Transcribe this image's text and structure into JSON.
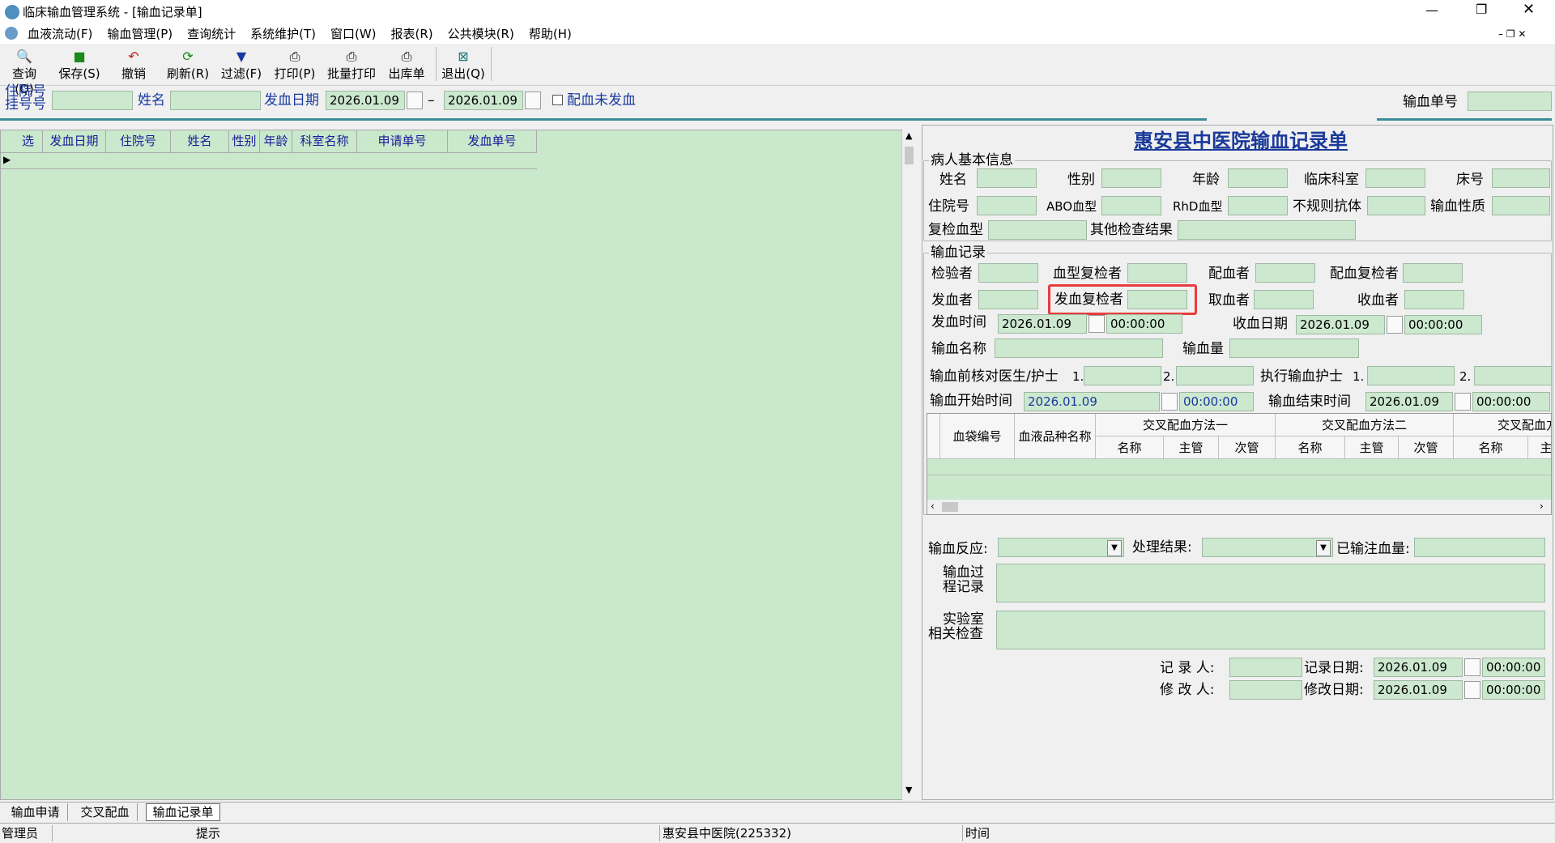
{
  "window": {
    "title": "临床输血管理系统 - [输血记录单]"
  },
  "menu": [
    "血液流动(F)",
    "输血管理(P)",
    "查询统计",
    "系统维护(T)",
    "窗口(W)",
    "报表(R)",
    "公共模块(R)",
    "帮助(H)"
  ],
  "toolbar": {
    "query": "查询(Q)",
    "save": "保存(S)",
    "undo": "撤销",
    "refresh": "刷新(R)",
    "filter": "过滤(F)",
    "print": "打印(P)",
    "batch_print": "批量打印",
    "outbound": "出库单",
    "exit": "退出(Q)"
  },
  "filter": {
    "inpatient_label_1": "住院号",
    "inpatient_label_2": "挂号号",
    "name_label": "姓名",
    "date_label": "发血日期",
    "date_from": "2026.01.09",
    "date_to": "2026.01.09",
    "dash": "–",
    "matched_label": "配血未发血",
    "order_no_label": "输血单号"
  },
  "list": {
    "columns": [
      "选",
      "发血日期",
      "住院号",
      "姓名",
      "性别",
      "年龄",
      "科室名称",
      "申请单号",
      "发血单号"
    ]
  },
  "form": {
    "title": "惠安县中医院输血记录单",
    "patient": {
      "group": "病人基本信息",
      "name": "姓名",
      "gender": "性别",
      "age": "年龄",
      "dept": "临床科室",
      "bed": "床号",
      "inpatient": "住院号",
      "abo": "ABO血型",
      "rhd": "RhD血型",
      "irregular": "不规则抗体",
      "nature": "输血性质",
      "recheck": "复检血型",
      "other": "其他检查结果"
    },
    "record": {
      "group": "输血记录",
      "inspector": "检验者",
      "type_recheck": "血型复检者",
      "matcher": "配血者",
      "match_recheck": "配血复检者",
      "issuer": "发血者",
      "issue_recheck": "发血复检者",
      "taker": "取血者",
      "receiver": "收血者",
      "issue_time": "发血时间",
      "issue_date": "2026.01.09",
      "issue_clock": "00:00:00",
      "receive_date_label": "收血日期",
      "receive_date": "2026.01.09",
      "receive_clock": "00:00:00",
      "blood_name": "输血名称",
      "volume": "输血量",
      "checker_label": "输血前核对医生/护士",
      "n1": "1.",
      "n2": "2.",
      "exec_nurse": "执行输血护士",
      "start_label": "输血开始时间",
      "start_date": "2026.01.09",
      "start_clock": "00:00:00",
      "end_label": "输血结束时间",
      "end_date": "2026.01.09",
      "end_clock": "00:00:00"
    },
    "table": {
      "bag_no": "血袋编号",
      "variety": "血液品种名称",
      "method1": "交叉配血方法一",
      "method2": "交叉配血方法二",
      "method3": "交叉配血方法",
      "sub_name": "名称",
      "sub_main": "主管",
      "sub_minor": "次管"
    },
    "reaction": "输血反应:",
    "result": "处理结果:",
    "infused": "已输注血量:",
    "process_1": "输血过",
    "process_2": "程记录",
    "lab_1": "实验室",
    "lab_2": "相关检查",
    "recorder": "记 录 人:",
    "record_date_label": "记录日期:",
    "record_date": "2026.01.09",
    "record_clock": "00:00:00",
    "modifier": "修 改 人:",
    "modify_date_label": "修改日期:",
    "modify_date": "2026.01.09",
    "modify_clock": "00:00:00"
  },
  "tabs": [
    "输血申请",
    "交叉配血",
    "输血记录单"
  ],
  "status": {
    "user": "管理员",
    "hint": "提示",
    "hospital": "惠安县中医院(225332)",
    "time": "时间"
  }
}
